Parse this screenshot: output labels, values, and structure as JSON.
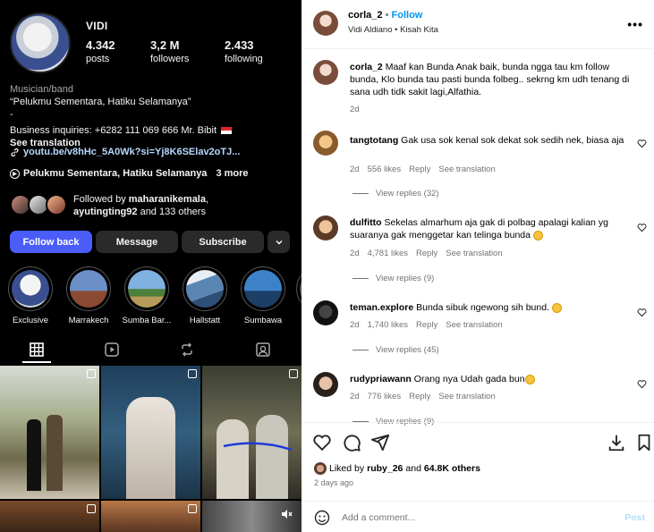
{
  "profile": {
    "username": "VIDI",
    "stats": [
      {
        "value": "4.342",
        "label": "posts"
      },
      {
        "value": "3,2 M",
        "label": "followers"
      },
      {
        "value": "2.433",
        "label": "following"
      }
    ],
    "category": "Musician/band",
    "bio_line1": "“Pelukmu Sementara, Hatiku Selamanya”",
    "bio_line2": "-",
    "bio_line3": "Business inquiries: +6282 111 069 666 Mr. Bibit",
    "see_translation": "See translation",
    "link": "youtu.be/v8hHc_5A0Wk?si=Yj8K6SElav2oTJ...",
    "threads_text": "Pelukmu Sementara, Hatiku Selamanya",
    "threads_more": "3 more",
    "followed_by_prefix": "Followed by ",
    "followed_by_user1": "maharanikemala",
    "followed_by_user2": "ayutingting92",
    "followed_by_rest": " and 133 others"
  },
  "buttons": {
    "follow_back": "Follow back",
    "message": "Message",
    "subscribe": "Subscribe"
  },
  "highlights": [
    {
      "label": "Exclusive",
      "c1": "#f4f4f4",
      "c2": "#3a4f8f"
    },
    {
      "label": "Marrakech",
      "c1": "#6b90c8",
      "c2": "#8a4b32"
    },
    {
      "label": "Sumba Bar...",
      "c1": "#7fb2e0",
      "c2": "#b89a5a"
    },
    {
      "label": "Hallstatt",
      "c1": "#5b86b3",
      "c2": "#e7eef6"
    },
    {
      "label": "Sumbawa",
      "c1": "#3d82c9",
      "c2": "#1d3e66"
    }
  ],
  "post": {
    "author": "corla_2",
    "follow": "Follow",
    "dot": "•",
    "audio_artist": "Vidi Aldiano",
    "audio_song": "Kisah Kita",
    "caption_user": "corla_2",
    "caption_text": "Maaf kan Bunda Anak baik, bunda ngga tau km follow bunda, Klo bunda tau pasti bunda folbeg.. sekrng km udh tenang di sana udh tidk sakit lagi,Alfathia.",
    "caption_age": "2d"
  },
  "comments": [
    {
      "user": "tangtotang",
      "text": "Gak usa sok kenal sok dekat sok sedih nek, biasa aja",
      "age": "2d",
      "likes": "556 likes",
      "reply": "Reply",
      "translate": "See translation",
      "view_replies": "View replies (32)"
    },
    {
      "user": "dulfitto",
      "text": "Sekelas almarhum aja gak di polbag apalagi kalian yg suaranya gak menggetar kan telinga bunda",
      "age": "2d",
      "likes": "4,781 likes",
      "reply": "Reply",
      "translate": "See translation",
      "view_replies": "View replies (9)"
    },
    {
      "user": "teman.explore",
      "text": "Bunda sibuk ngewong sih bund.",
      "age": "2d",
      "likes": "1,740 likes",
      "reply": "Reply",
      "translate": "See translation",
      "view_replies": "View replies (45)"
    },
    {
      "user": "rudypriawann",
      "text": "Orang nya Udah gada bun",
      "age": "2d",
      "likes": "776 likes",
      "reply": "Reply",
      "translate": "See translation",
      "view_replies": "View replies (9)"
    }
  ],
  "footer": {
    "liked_by_prefix": "Liked by ",
    "liked_by_user": "ruby_26",
    "liked_by_and": " and ",
    "liked_by_count": "64.8K others",
    "date": "2 days ago",
    "add_comment_placeholder": "Add a comment...",
    "post_label": "Post"
  },
  "colors": {
    "accent_blue": "#4a5df9",
    "link_blue": "#0095f6"
  }
}
